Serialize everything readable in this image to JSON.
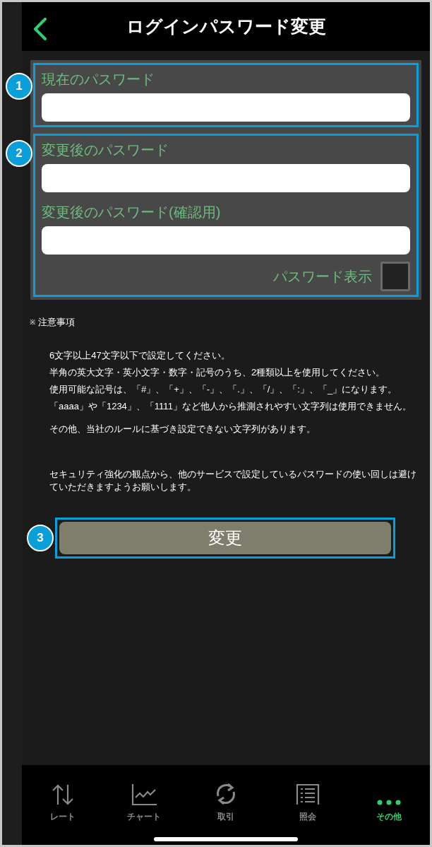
{
  "header": {
    "title": "ログインパスワード変更"
  },
  "sections": [
    {
      "badge": "1",
      "fields": [
        {
          "label": "現在のパスワード"
        }
      ]
    },
    {
      "badge": "2",
      "fields": [
        {
          "label": "変更後のパスワード"
        },
        {
          "label": "変更後のパスワード(確認用)"
        }
      ],
      "show_password": {
        "label": "パスワード表示",
        "checked": false
      }
    }
  ],
  "notes": {
    "mark": "※",
    "heading": "注意事項",
    "items": [
      "6文字以上47文字以下で設定してください。",
      "半角の英大文字・英小文字・数字・記号のうち、2種類以上を使用してください。",
      "使用可能な記号は、「#」、「+」、「-」、「.」、「/」、「:」、「_」になります。",
      "「aaaa」や「1234」、「1111」など他人から推測されやすい文字列は使用できません。",
      "その他、当社のルールに基づき設定できない文字列があります。",
      "セキュリティ強化の観点から、他のサービスで設定しているパスワードの使い回しは避けていただきますようお願いします。"
    ]
  },
  "submit": {
    "badge": "3",
    "label": "変更"
  },
  "tabs": [
    {
      "kind": "rate",
      "label": "レート",
      "selected": false
    },
    {
      "kind": "chart",
      "label": "チャート",
      "selected": false
    },
    {
      "kind": "trade",
      "label": "取引",
      "selected": false
    },
    {
      "kind": "inquiry",
      "label": "照会",
      "selected": false
    },
    {
      "kind": "more",
      "label": "その他",
      "selected": true
    }
  ]
}
